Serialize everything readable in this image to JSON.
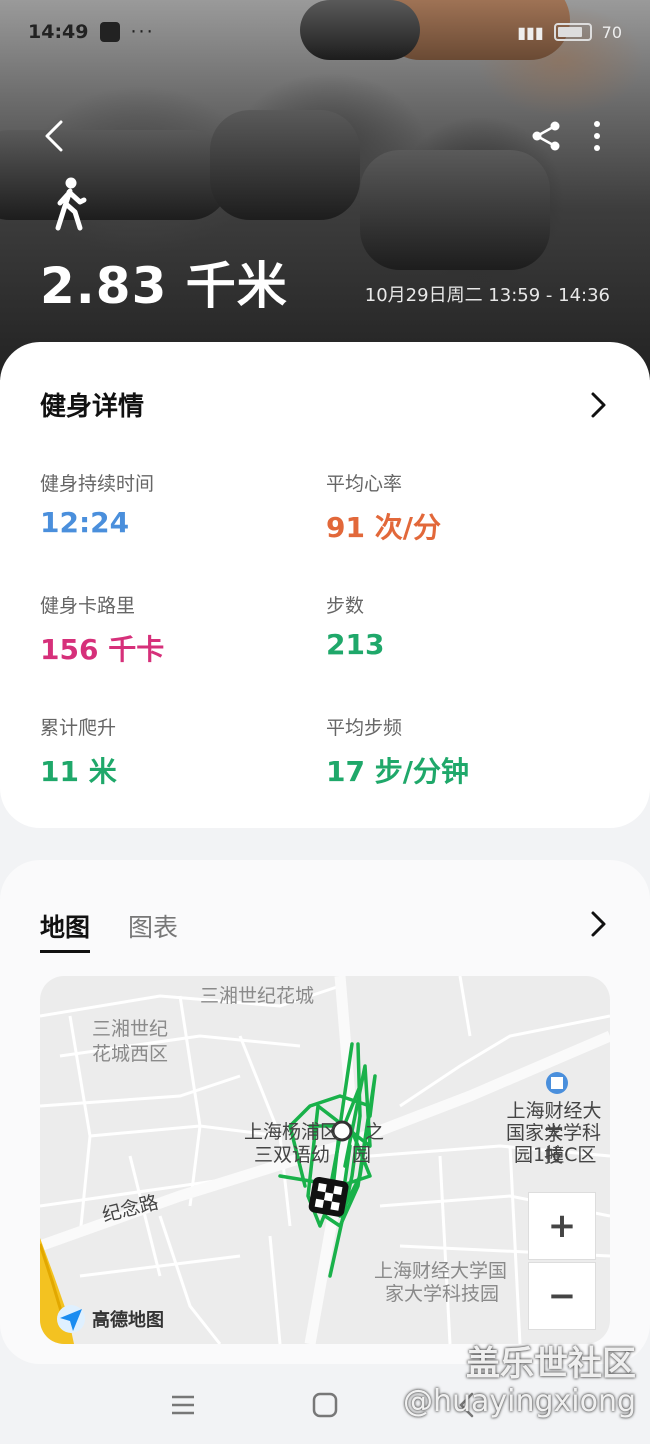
{
  "status_bar": {
    "time": "14:49",
    "dots": "···",
    "battery": "70"
  },
  "header": {
    "distance": "2.83 千米",
    "datetime": "10月29日周二 13:59 - 14:36"
  },
  "details": {
    "title": "健身详情",
    "stats": [
      {
        "label": "健身持续时间",
        "value": "12:24",
        "color": "#4a8fdc"
      },
      {
        "label": "平均心率",
        "value": "91 次/分",
        "color": "#e2683a"
      },
      {
        "label": "健身卡路里",
        "value": "156 千卡",
        "color": "#d6307a"
      },
      {
        "label": "步数",
        "value": "213",
        "color": "#1fa86a"
      },
      {
        "label": "累计爬升",
        "value": "11 米",
        "color": "#1fa86a"
      },
      {
        "label": "平均步频",
        "value": "17 步/分钟",
        "color": "#1fa86a"
      }
    ]
  },
  "map_card": {
    "tabs": [
      "地图",
      "图表"
    ],
    "map_labels": {
      "l1": "三湘世纪花城",
      "l2": "三湘世纪",
      "l2b": "花城西区",
      "l3": "上海杨浦区",
      "l3b": "之",
      "l3c": "三双语幼",
      "l3d": "园",
      "l4": "纪念路",
      "l5": "上海财经大学",
      "l5b": "国家大学科技",
      "l5c": "园1幢C区",
      "l6": "上海财经大学国",
      "l6b": "家大学科技园"
    },
    "zoom_in": "+",
    "zoom_out": "−",
    "provider": "高德地图"
  },
  "watermark": {
    "line1": "盖乐世社区",
    "line2": "@huayingxiong"
  },
  "colors": {
    "route": "#19b14a",
    "accent_blue": "#4a8fdc"
  }
}
